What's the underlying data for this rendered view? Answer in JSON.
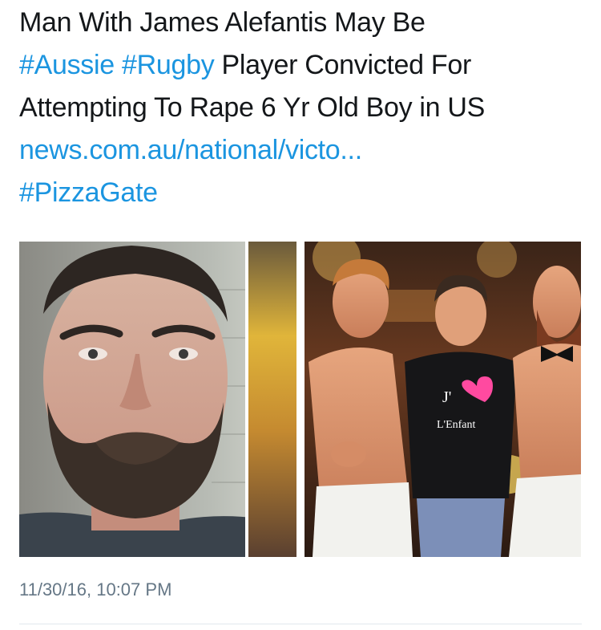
{
  "tweet": {
    "line1": "Man With James Alefantis May Be",
    "hashtag_aussie": "#Aussie",
    "hashtag_rugby": "#Rugby",
    "line2_rest": " Player Convicted For",
    "line3": "Attempting To Rape 6 Yr Old Boy in US",
    "link_text": "news.com.au/national/victo...",
    "hashtag_pizzagate": "#PizzaGate"
  },
  "media": {
    "left_photo": "photo-bearded-man",
    "right_photo": "photo-three-men",
    "tshirt_text_1": "J'",
    "tshirt_text_2": "L'Enfant"
  },
  "timestamp": "11/30/16, 10:07 PM",
  "colors": {
    "text": "#14171a",
    "link": "#1b95e0",
    "muted": "#657786",
    "divider": "#e1e8ed"
  }
}
